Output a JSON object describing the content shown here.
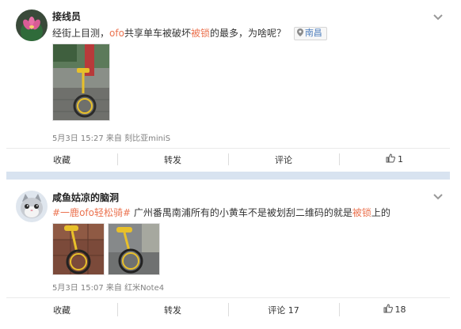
{
  "colors": {
    "highlight": "#eb7350",
    "location_blue": "#4f7fbf",
    "separator": "#d8e3f0"
  },
  "posts": [
    {
      "author": "接线员",
      "avatar_icon": "lotus-flower-avatar",
      "content": {
        "before": "经街上目测，",
        "keyword1": "ofo",
        "middle": "共享单车被破坏",
        "keyword2": "被锁",
        "after": "的最多，为啥呢？"
      },
      "location": "南昌",
      "meta": "5月3日 15:27 来自 刻比亚miniS",
      "actions": {
        "favorite": "收藏",
        "repost": "转发",
        "comment": "评论",
        "like": "1"
      }
    },
    {
      "author": "咸鱼姑凉的脑洞",
      "avatar_icon": "cat-avatar",
      "content": {
        "topic_open": "#一鹿",
        "topic_keyword": "ofo",
        "topic_close": "轻松骑#",
        "body": " 广州番禺南浦所有的小黄车不是被划刮二维码的就是",
        "keyword": "被锁",
        "tail": "上的"
      },
      "meta": "5月3日 15:07 来自 红米Note4",
      "actions": {
        "favorite": "收藏",
        "repost": "转发",
        "comment": "评论 17",
        "like": "18"
      }
    }
  ]
}
